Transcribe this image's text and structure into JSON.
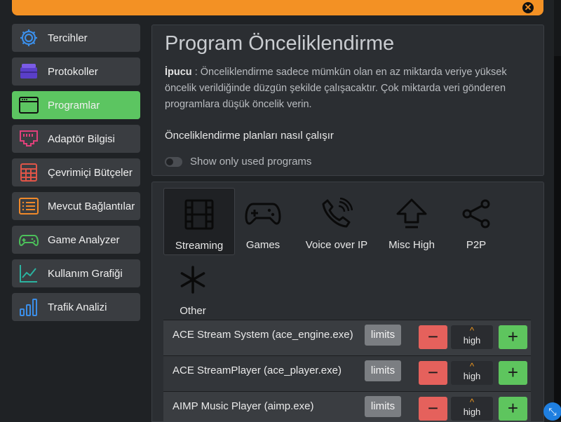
{
  "colors": {
    "accent_orange": "#f39124",
    "active_green": "#5cc561",
    "minus_red": "#e5615c",
    "plus_green": "#5ec55e"
  },
  "sidebar": {
    "items": [
      {
        "label": "Tercihler",
        "icon": "gear-icon"
      },
      {
        "label": "Protokoller",
        "icon": "protocols-icon"
      },
      {
        "label": "Programlar",
        "icon": "window-icon",
        "active": true
      },
      {
        "label": "Adaptör Bilgisi",
        "icon": "ethernet-icon"
      },
      {
        "label": "Çevrimiçi Bütçeler",
        "icon": "calculator-icon"
      },
      {
        "label": "Mevcut Bağlantılar",
        "icon": "list-icon"
      },
      {
        "label": "Game Analyzer",
        "icon": "gamepad-icon"
      },
      {
        "label": "Kullanım Grafiği",
        "icon": "line-chart-icon"
      },
      {
        "label": "Trafik Analizi",
        "icon": "bar-chart-icon"
      }
    ]
  },
  "main": {
    "title": "Program Önceliklendirme",
    "tip_label": "İpucu",
    "tip_text": " : Önceliklendirme sadece mümkün olan en az miktarda veriye yüksek öncelik verildiğinde düzgün şekilde çalışacaktır. Çok miktarda veri gönderen programlara düşük öncelik verin.",
    "how_link": "Önceliklendirme planları nasıl çalışır",
    "toggle_label": "Show only used programs"
  },
  "categories": [
    {
      "label": "Streaming",
      "icon": "film-icon",
      "active": true
    },
    {
      "label": "Games",
      "icon": "gamepad-icon"
    },
    {
      "label": "Voice over IP",
      "icon": "phone-icon"
    },
    {
      "label": "Misc High",
      "icon": "arrow-up-icon"
    },
    {
      "label": "P2P",
      "icon": "share-icon"
    },
    {
      "label": "Other",
      "icon": "asterisk-icon"
    }
  ],
  "programs": [
    {
      "name": "ACE Stream System (ace_engine.exe)",
      "limits": "limits",
      "priority": "high",
      "minus": "−",
      "plus": "+",
      "arrow": "^"
    },
    {
      "name": "ACE StreamPlayer (ace_player.exe)",
      "limits": "limits",
      "priority": "high",
      "minus": "−",
      "plus": "+",
      "arrow": "^"
    },
    {
      "name": "AIMP Music Player (aimp.exe)",
      "limits": "limits",
      "priority": "high",
      "minus": "−",
      "plus": "+",
      "arrow": "^"
    }
  ]
}
